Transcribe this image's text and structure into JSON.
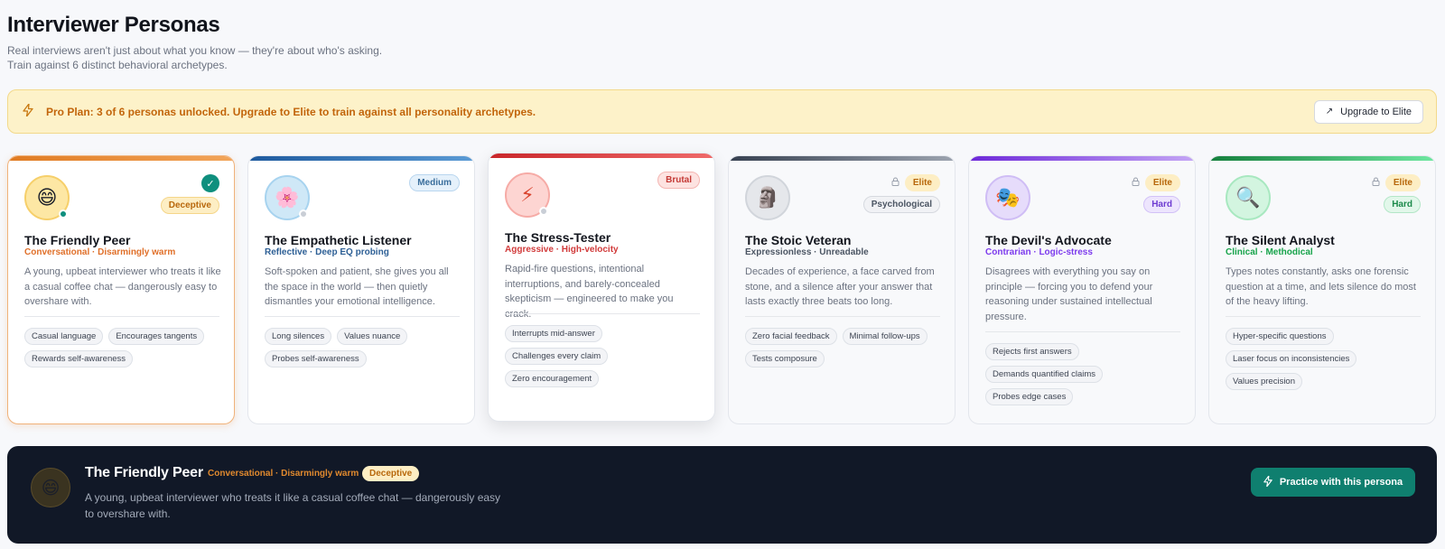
{
  "header": {
    "title": "Interviewer Personas",
    "subtitle": "Real interviews aren't just about what you know — they're about who's asking. Train against 6 distinct behavioral archetypes."
  },
  "banner": {
    "icon": "lightning-icon",
    "text": "Pro Plan: 3 of 6 personas unlocked. Upgrade to Elite to train against all personality archetypes.",
    "upgrade_label": "Upgrade to Elite"
  },
  "personas": [
    {
      "name": "The Friendly Peer",
      "tagline": "Conversational · Disarmingly warm",
      "difficulty": "Deceptive",
      "emoji": "😄",
      "description": "A young, upbeat interviewer who treats it like a casual coffee chat — dangerously easy to overshare with.",
      "tags": [
        "Casual language",
        "Encourages tangents",
        "Rewards self-awareness"
      ],
      "selected": true,
      "accent": "#e07b22"
    },
    {
      "name": "The Empathetic Listener",
      "tagline": "Reflective · Deep EQ probing",
      "difficulty": "Medium",
      "emoji": "🌸",
      "description": "Soft-spoken and patient, she gives you all the space in the world — then quietly dismantles your emotional intelligence.",
      "tags": [
        "Long silences",
        "Values nuance",
        "Probes self-awareness"
      ],
      "accent": "#2563a8"
    },
    {
      "name": "The Stress-Tester",
      "tagline": "Aggressive · High-velocity",
      "difficulty": "Brutal",
      "emoji": "⚡",
      "description": "Rapid-fire questions, intentional interruptions, and barely-concealed skepticism — engineered to make you crack.",
      "tags": [
        "Interrupts mid-answer",
        "Challenges every claim",
        "Zero encouragement"
      ],
      "accent": "#d63a3a"
    },
    {
      "name": "The Stoic Veteran",
      "tagline": "Expressionless · Unreadable",
      "difficulty": "Psychological",
      "locked_label": "Elite",
      "emoji": "🗿",
      "description": "Decades of experience, a face carved from stone, and a silence after your answer that lasts exactly three beats too long.",
      "tags": [
        "Zero facial feedback",
        "Minimal follow-ups",
        "Tests composure"
      ],
      "accent": "#4b5563"
    },
    {
      "name": "The Devil's Advocate",
      "tagline": "Contrarian · Logic-stress",
      "difficulty": "Hard",
      "locked_label": "Elite",
      "emoji": "🎭",
      "description": "Disagrees with everything you say on principle — forcing you to defend your reasoning under sustained intellectual pressure.",
      "tags": [
        "Rejects first answers",
        "Demands quantified claims",
        "Probes edge cases"
      ],
      "accent": "#7c3aed"
    },
    {
      "name": "The Silent Analyst",
      "tagline": "Clinical · Methodical",
      "difficulty": "Hard",
      "locked_label": "Elite",
      "emoji": "🔍",
      "description": "Types notes constantly, asks one forensic question at a time, and lets silence do most of the heavy lifting.",
      "tags": [
        "Hyper-specific questions",
        "Laser focus on inconsistencies",
        "Values precision"
      ],
      "accent": "#16a34a"
    }
  ],
  "footer": {
    "name": "The Friendly Peer",
    "tagline": "Conversational · Disarmingly warm",
    "badge": "Deceptive",
    "emoji": "😄",
    "description": "A young, upbeat interviewer who treats it like a casual coffee chat — dangerously easy to overshare with.",
    "practice_label": "Practice with this persona"
  }
}
